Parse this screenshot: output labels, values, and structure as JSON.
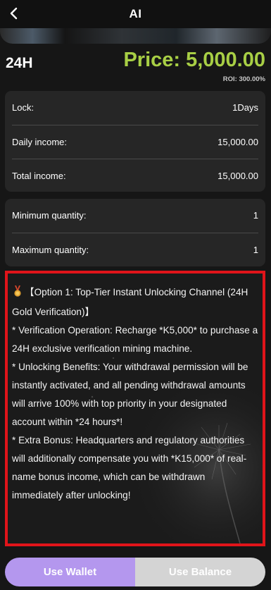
{
  "header": {
    "title": "AI"
  },
  "product": {
    "name": "24H",
    "price": "Price: 5,000.00",
    "roi": "ROI: 300.00%"
  },
  "details": [
    {
      "label": "Lock:",
      "value": "1Days"
    },
    {
      "label": "Daily income:",
      "value": "15,000.00"
    },
    {
      "label": "Total income:",
      "value": "15,000.00"
    }
  ],
  "quantity": [
    {
      "label": "Minimum quantity:",
      "value": "1"
    },
    {
      "label": "Maximum quantity:",
      "value": "1"
    }
  ],
  "description": {
    "title": "【Option 1: Top-Tier Instant Unlocking Channel (24H Gold Verification)】",
    "item1": "*   Verification Operation: Recharge *K5,000* to purchase a 24H exclusive verification mining machine.",
    "item2": "*   Unlocking Benefits: Your withdrawal permission will be instantly activated, and all pending withdrawal amounts will arrive 100% with top priority in your designated account within *24 hours*!",
    "item3": "*   Extra Bonus: Headquarters and regulatory authorities will additionally compensate you with *K15,000* of real-name bonus income, which can be withdrawn immediately after unlocking!"
  },
  "actions": {
    "wallet": "Use Wallet",
    "balance": "Use Balance"
  },
  "colors": {
    "price": "#a8cf45",
    "highlight_border": "#e0141a",
    "wallet_button": "#b497ee",
    "balance_button": "#d4d4d4"
  },
  "icons": {
    "back": "chevron-left-icon",
    "medal": "medal-icon"
  }
}
